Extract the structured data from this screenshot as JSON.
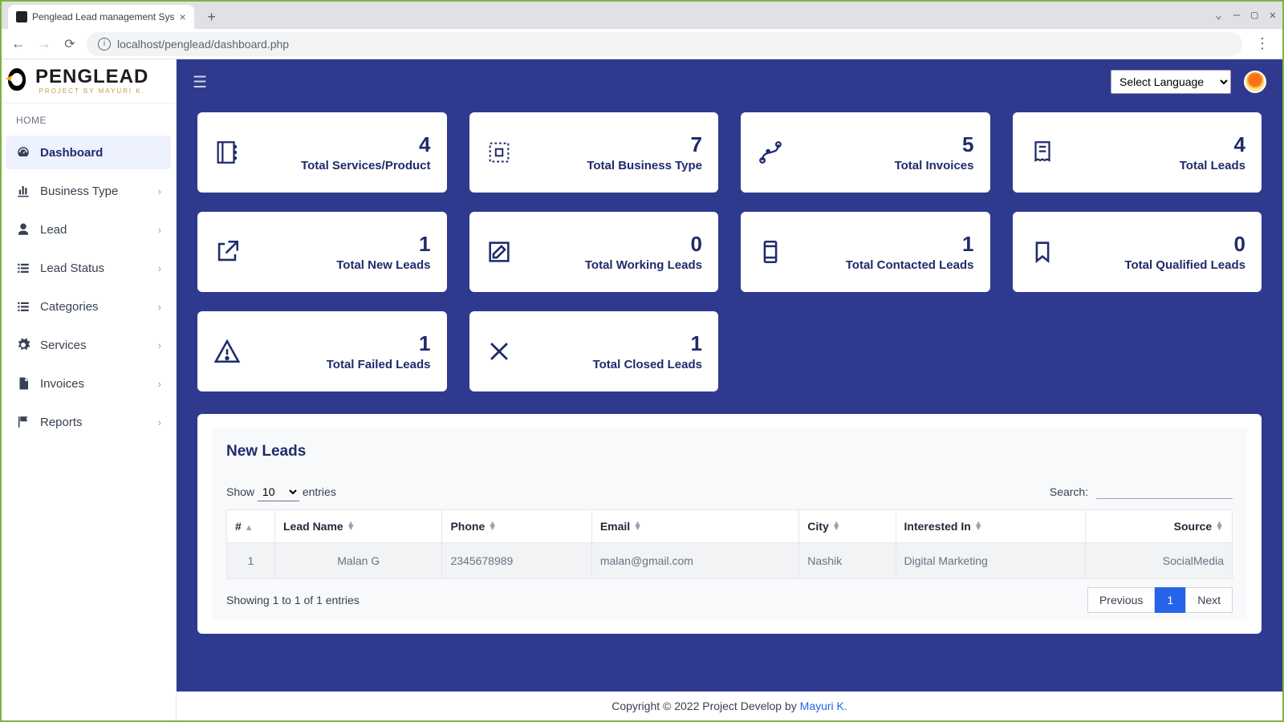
{
  "browser": {
    "tab_title": "Penglead Lead management Sys",
    "url": "localhost/penglead/dashboard.php"
  },
  "logo": {
    "name": "PENGLEAD",
    "sub": "PROJECT BY MAYURI K."
  },
  "sidebar": {
    "home_label": "HOME",
    "items": [
      {
        "label": "Dashboard"
      },
      {
        "label": "Business Type"
      },
      {
        "label": "Lead"
      },
      {
        "label": "Lead Status"
      },
      {
        "label": "Categories"
      },
      {
        "label": "Services"
      },
      {
        "label": "Invoices"
      },
      {
        "label": "Reports"
      }
    ]
  },
  "topbar": {
    "language_placeholder": "Select Language"
  },
  "cards": [
    {
      "num": "4",
      "label": "Total Services/Product"
    },
    {
      "num": "7",
      "label": "Total Business Type"
    },
    {
      "num": "5",
      "label": "Total Invoices"
    },
    {
      "num": "4",
      "label": "Total Leads"
    },
    {
      "num": "1",
      "label": "Total New Leads"
    },
    {
      "num": "0",
      "label": "Total Working Leads"
    },
    {
      "num": "1",
      "label": "Total Contacted Leads"
    },
    {
      "num": "0",
      "label": "Total Qualified Leads"
    },
    {
      "num": "1",
      "label": "Total Failed Leads"
    },
    {
      "num": "1",
      "label": "Total Closed Leads"
    }
  ],
  "table": {
    "title": "New Leads",
    "show_label": "Show",
    "entries_label": "entries",
    "page_size": "10",
    "search_label": "Search:",
    "headers": [
      "#",
      "Lead Name",
      "Phone",
      "Email",
      "City",
      "Interested In",
      "Source"
    ],
    "rows": [
      {
        "idx": "1",
        "name": "Malan G",
        "phone": "2345678989",
        "email": "malan@gmail.com",
        "city": "Nashik",
        "interest": "Digital Marketing",
        "source": "SocialMedia"
      }
    ],
    "info": "Showing 1 to 1 of 1 entries",
    "prev": "Previous",
    "next": "Next",
    "page": "1"
  },
  "footer": {
    "text": "Copyright © 2022 Project Develop by ",
    "link": "Mayuri K."
  }
}
